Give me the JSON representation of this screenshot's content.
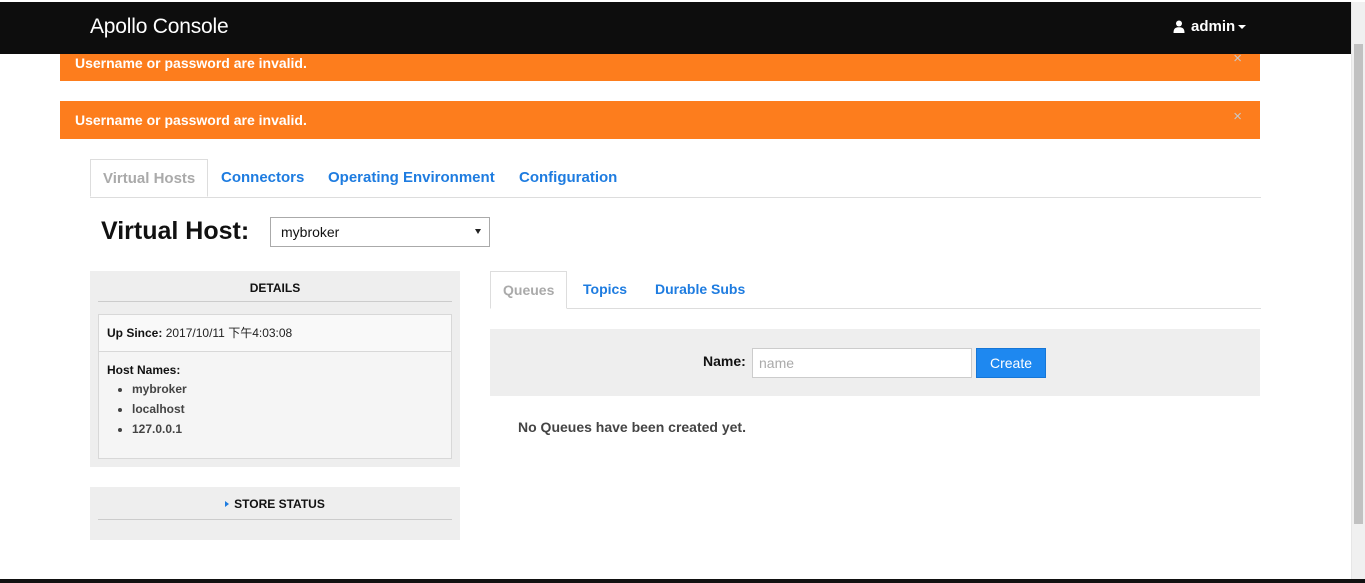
{
  "app": {
    "title": "Apollo Console",
    "user": "admin"
  },
  "alerts": [
    {
      "message": "Username or password are invalid.",
      "close": "×"
    },
    {
      "message": "Username or password are invalid.",
      "close": "×"
    }
  ],
  "main_tabs": [
    {
      "label": "Virtual Hosts",
      "active": true
    },
    {
      "label": "Connectors",
      "active": false
    },
    {
      "label": "Operating Environment",
      "active": false
    },
    {
      "label": "Configuration",
      "active": false
    }
  ],
  "virtual_host": {
    "label": "Virtual Host:",
    "selected": "mybroker"
  },
  "details": {
    "title": "DETAILS",
    "up_since_label": "Up Since:",
    "up_since_value": "2017/10/11 下午4:03:08",
    "host_names_label": "Host Names:",
    "host_names": [
      "mybroker",
      "localhost",
      "127.0.0.1"
    ]
  },
  "store_status": {
    "title": "STORE STATUS"
  },
  "sub_tabs": [
    {
      "label": "Queues",
      "active": true
    },
    {
      "label": "Topics",
      "active": false
    },
    {
      "label": "Durable Subs",
      "active": false
    }
  ],
  "create_form": {
    "name_label": "Name:",
    "name_placeholder": "name",
    "create_label": "Create"
  },
  "empty_message": "No Queues have been created yet.",
  "colors": {
    "navbar": "#0d0d0d",
    "alert": "#fd7d1d",
    "link": "#1e7ce0",
    "button": "#1e88f0"
  },
  "icons": {
    "user": "user-icon",
    "caret_down": "caret-down-icon",
    "close": "close-icon",
    "caret_right": "caret-right-icon",
    "select_arrow": "select-arrow-icon"
  }
}
